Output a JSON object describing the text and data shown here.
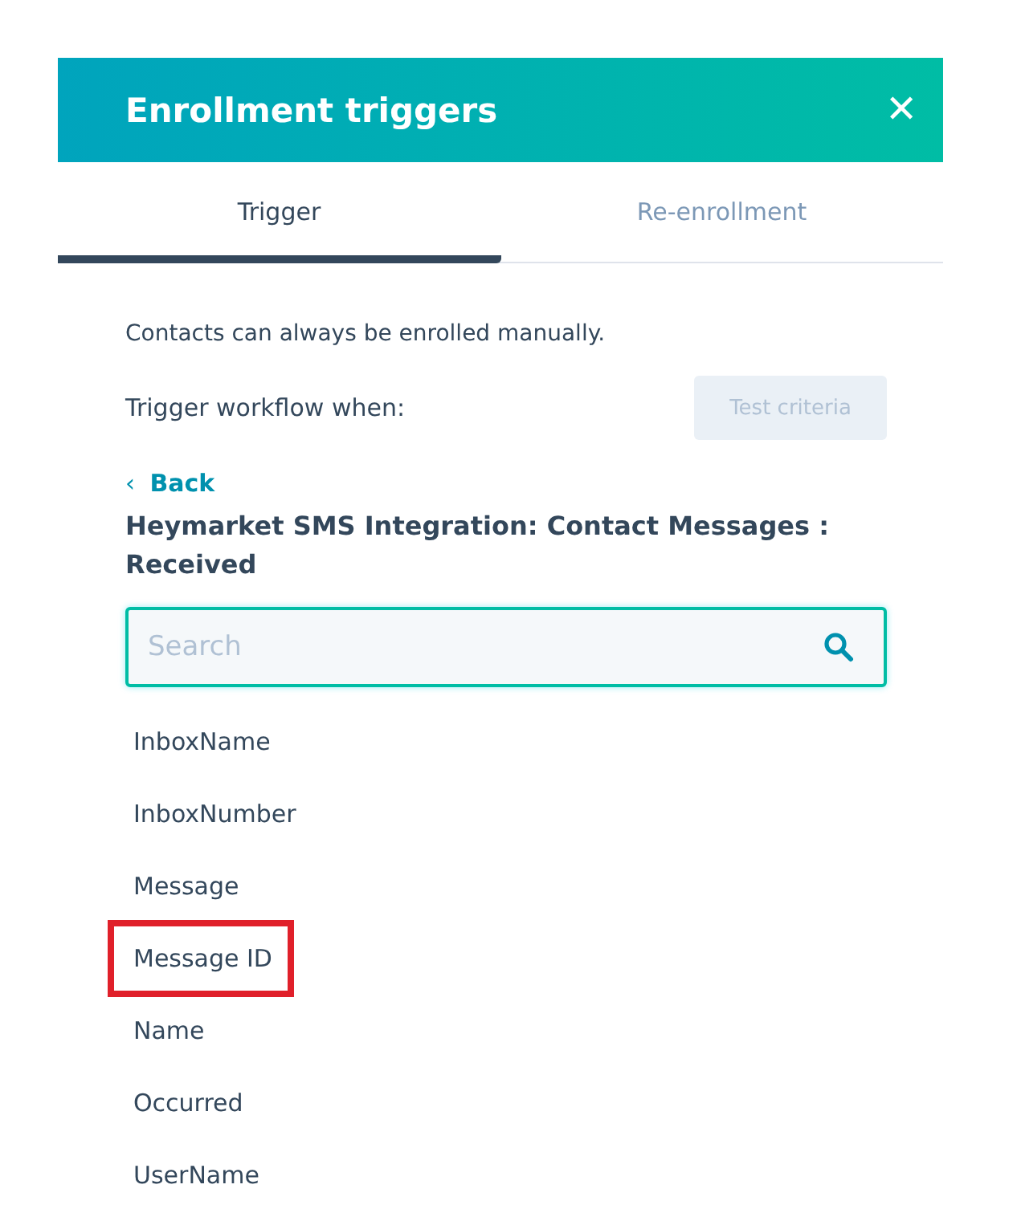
{
  "header": {
    "title": "Enrollment triggers",
    "close": "✕"
  },
  "tabs": [
    {
      "label": "Trigger",
      "selected": true
    },
    {
      "label": "Re-enrollment",
      "selected": false
    }
  ],
  "note": "Contacts can always be enrolled manually.",
  "trigger_label": "Trigger workflow when:",
  "test_button": {
    "label": "Test criteria",
    "disabled": true
  },
  "back": {
    "icon": "‹",
    "label": "Back"
  },
  "heading": "Heymarket SMS Integration: Contact Messages : Received",
  "search": {
    "placeholder": "Search"
  },
  "properties": [
    {
      "label": "InboxName",
      "highlighted": false
    },
    {
      "label": "InboxNumber",
      "highlighted": false
    },
    {
      "label": "Message",
      "highlighted": false
    },
    {
      "label": "Message ID",
      "highlighted": true
    },
    {
      "label": "Name",
      "highlighted": false
    },
    {
      "label": "Occurred",
      "highlighted": false
    },
    {
      "label": "UserName",
      "highlighted": false
    }
  ]
}
